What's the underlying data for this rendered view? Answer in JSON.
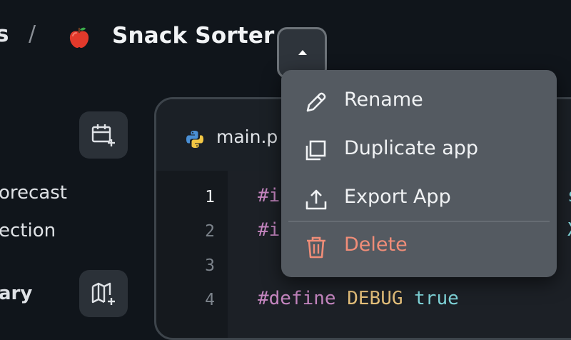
{
  "breadcrumb": {
    "previous": "s",
    "separator": "/",
    "app_icon": "apple-icon",
    "app_name": "Snack Sorter",
    "toggle_icon": "caret-up-icon"
  },
  "sidebar": {
    "items": [
      {
        "label": "orecast"
      },
      {
        "label": "ection"
      },
      {
        "label": "ary"
      }
    ],
    "buttons": [
      {
        "icon": "add-calendar-icon"
      },
      {
        "icon": "add-map-icon"
      }
    ]
  },
  "editor": {
    "tab": {
      "icon": "python-icon",
      "label": "main.p"
    },
    "gutter": [
      "1",
      "2",
      "3",
      "4"
    ],
    "lines": [
      {
        "directive": "#i"
      },
      {
        "directive": "#i"
      },
      {
        "directive": ""
      },
      {
        "directive": "#define",
        "macro": "DEBUG",
        "value": "true"
      }
    ],
    "cut_right": [
      "sc",
      "X."
    ]
  },
  "menu": {
    "items": [
      {
        "label": "Rename",
        "icon": "pencil-icon"
      },
      {
        "label": "Duplicate app",
        "icon": "duplicate-icon"
      },
      {
        "label": "Export App",
        "icon": "export-icon"
      },
      {
        "label": "Delete",
        "icon": "trash-icon",
        "danger": true
      }
    ]
  },
  "colors": {
    "danger": "#f08d78",
    "menu_bg": "#545a61",
    "background": "#10151b"
  }
}
